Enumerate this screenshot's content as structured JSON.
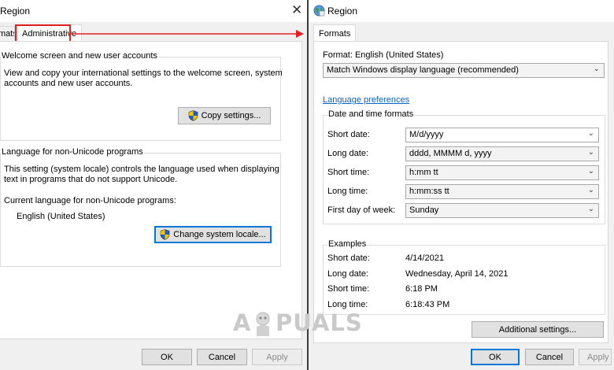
{
  "left_window": {
    "title": "Region",
    "tabs": {
      "formats_partial": "mats",
      "administrative": "Administrative"
    },
    "welcome_group": {
      "label": "Welcome screen and new user accounts",
      "line1": "View and copy your international settings to the welcome screen, system",
      "line2": "accounts and new user accounts.",
      "copy_button": "Copy settings..."
    },
    "unicode_group": {
      "label": "Language for non-Unicode programs",
      "line1": "This setting (system locale) controls the language used when displaying",
      "line2": "text in programs that do not support Unicode.",
      "current_label": "Current language for non-Unicode programs:",
      "current_value": "English (United States)",
      "change_button": "Change system locale..."
    },
    "buttons": {
      "ok": "OK",
      "cancel": "Cancel",
      "apply": "Apply"
    }
  },
  "right_window": {
    "title": "Region",
    "tab": "Formats",
    "format_label": "Format: English (United States)",
    "format_select": "Match Windows display language (recommended)",
    "language_link": "Language preferences",
    "datetime_group": {
      "label": "Date and time formats",
      "rows": [
        {
          "label": "Short date:",
          "value": "M/d/yyyy"
        },
        {
          "label": "Long date:",
          "value": "dddd, MMMM d, yyyy"
        },
        {
          "label": "Short time:",
          "value": "h:mm tt"
        },
        {
          "label": "Long time:",
          "value": "h:mm:ss tt"
        },
        {
          "label": "First day of week:",
          "value": "Sunday"
        }
      ]
    },
    "examples_group": {
      "label": "Examples",
      "rows": [
        {
          "label": "Short date:",
          "value": "4/14/2021"
        },
        {
          "label": "Long date:",
          "value": "Wednesday, April 14, 2021"
        },
        {
          "label": "Short time:",
          "value": "6:18 PM"
        },
        {
          "label": "Long time:",
          "value": "6:18:43 PM"
        }
      ]
    },
    "additional_button": "Additional settings...",
    "buttons": {
      "ok": "OK",
      "cancel": "Cancel",
      "apply": "Apply"
    }
  },
  "watermark": {
    "part1": "A",
    "part2": "PUALS"
  },
  "colors": {
    "highlight": "#e02020",
    "link": "#0066cc",
    "focus": "#0078d7"
  },
  "icons": [
    "close-icon",
    "region-globe-icon",
    "uac-shield-icon",
    "chevron-down-icon",
    "arrow-icon"
  ]
}
